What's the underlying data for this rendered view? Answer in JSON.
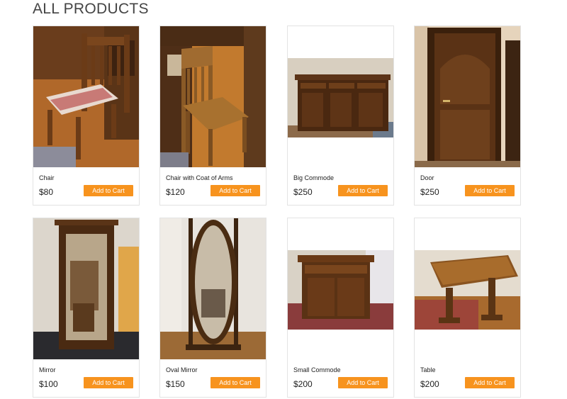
{
  "page": {
    "title": "ALL PRODUCTS"
  },
  "products": [
    {
      "name": "Chair",
      "price": "$80",
      "button": "Add to Cart"
    },
    {
      "name": "Chair with Coat of Arms",
      "price": "$120",
      "button": "Add to Cart"
    },
    {
      "name": "Big Commode",
      "price": "$250",
      "button": "Add to Cart"
    },
    {
      "name": "Door",
      "price": "$250",
      "button": "Add to Cart"
    },
    {
      "name": "Mirror",
      "price": "$100",
      "button": "Add to Cart"
    },
    {
      "name": "Oval Mirror",
      "price": "$150",
      "button": "Add to Cart"
    },
    {
      "name": "Small Commode",
      "price": "$200",
      "button": "Add to Cart"
    },
    {
      "name": "Table",
      "price": "$200",
      "button": "Add to Cart"
    }
  ],
  "colors": {
    "button": "#f7931e",
    "wood": "#5a3417",
    "floor": "#b8752e"
  }
}
